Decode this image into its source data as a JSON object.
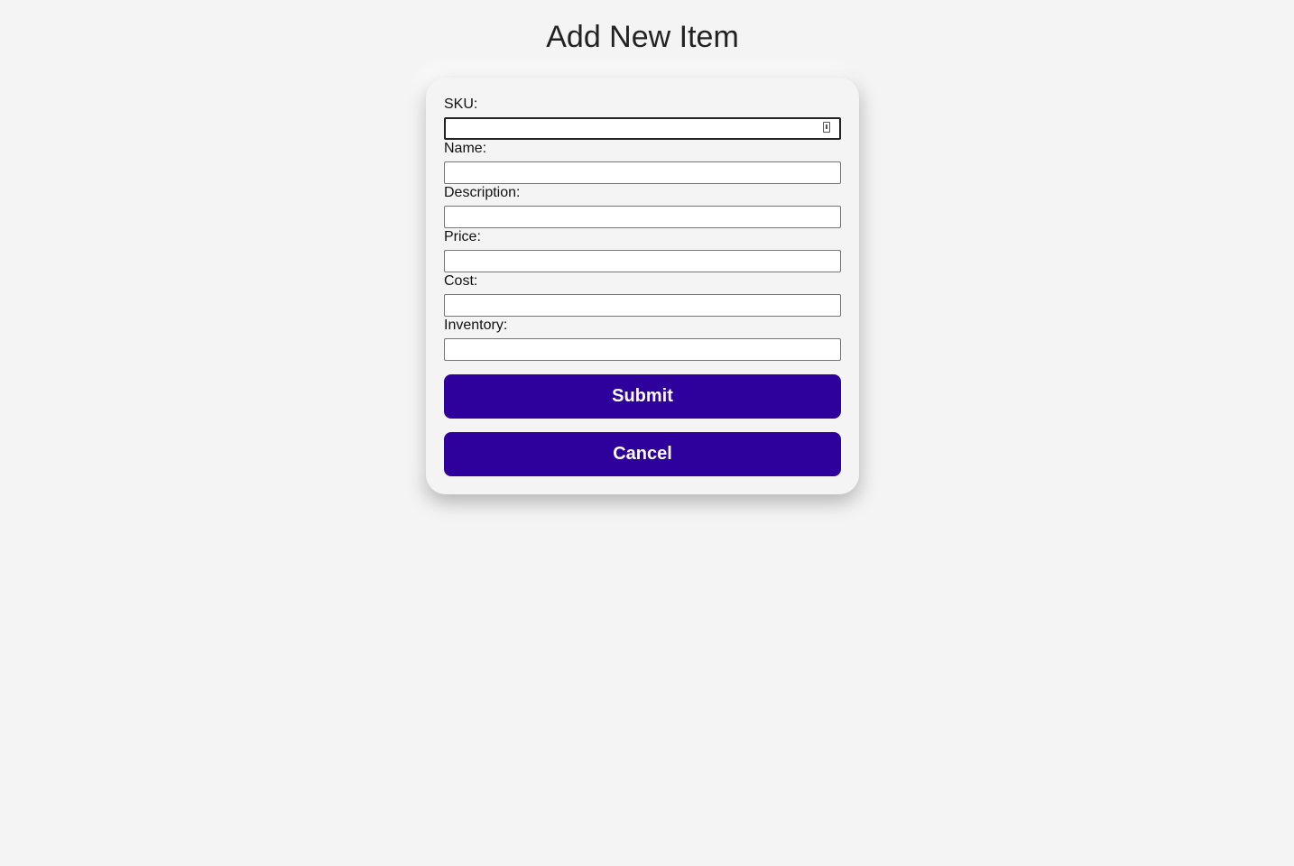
{
  "page": {
    "title": "Add New Item"
  },
  "form": {
    "fields": [
      {
        "label": "SKU:",
        "value": "",
        "placeholder": ""
      },
      {
        "label": "Name:",
        "value": "",
        "placeholder": ""
      },
      {
        "label": "Description:",
        "value": "",
        "placeholder": ""
      },
      {
        "label": "Price:",
        "value": "",
        "placeholder": ""
      },
      {
        "label": "Cost:",
        "value": "",
        "placeholder": ""
      },
      {
        "label": "Inventory:",
        "value": "",
        "placeholder": ""
      }
    ],
    "submit_label": "Submit",
    "cancel_label": "Cancel"
  },
  "colors": {
    "button_bg": "#2e009c",
    "button_text": "#ffffff",
    "page_bg": "#f4f4f4"
  },
  "icons": {
    "sku_field_icon": "autofill-key-icon"
  }
}
